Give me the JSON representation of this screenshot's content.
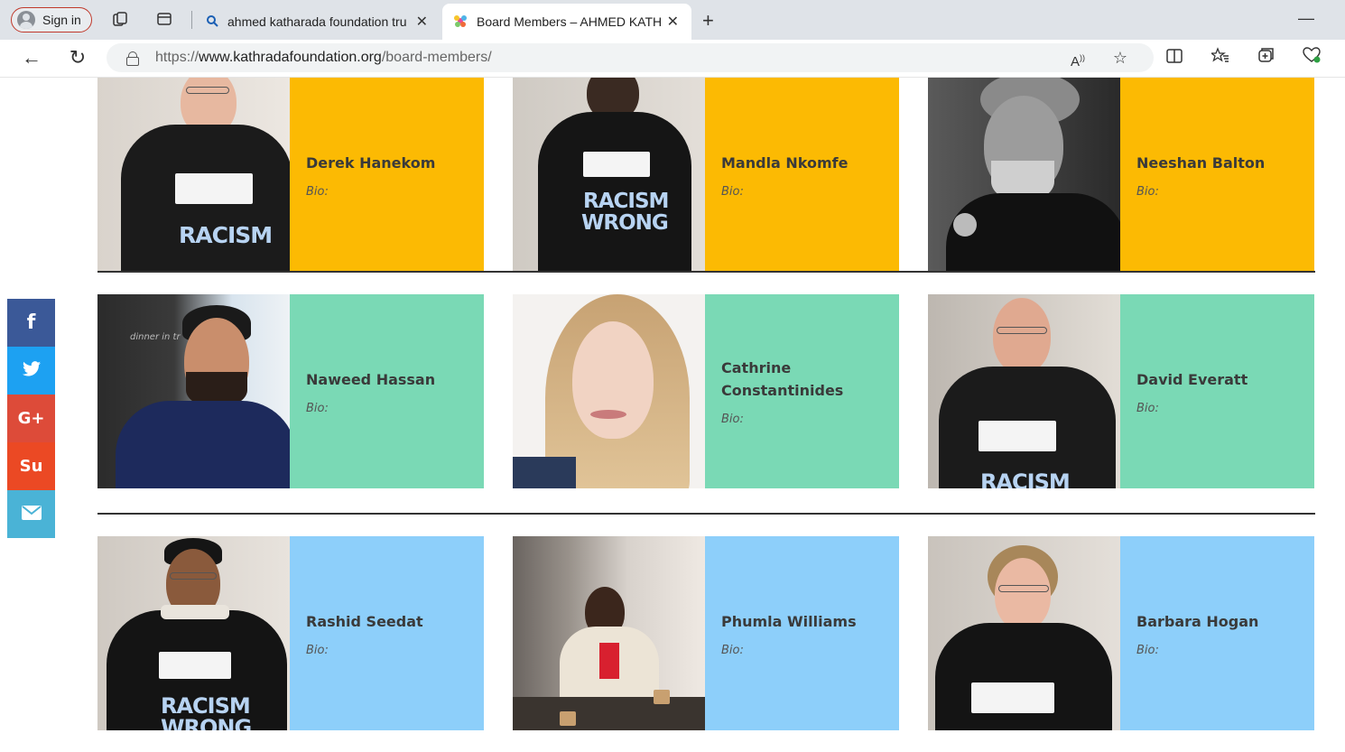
{
  "browser": {
    "signin_label": "Sign in",
    "tabs": [
      {
        "title": "ahmed katharada foundation tru",
        "active": false,
        "icon": "search-icon"
      },
      {
        "title": "Board Members – AHMED KATH",
        "active": true,
        "icon": "pinwheel-favicon"
      }
    ],
    "url_prefix": "https://",
    "url_host": "www.kathradafoundation.org",
    "url_path": "/board-members/"
  },
  "colors": {
    "row1": "#fcba03",
    "row2": "#7ad9b5",
    "row3": "#8dcffa"
  },
  "rows": [
    {
      "members": [
        {
          "name": "Derek Hanekom",
          "bio": "Bio:"
        },
        {
          "name": "Mandla Nkomfe",
          "bio": "Bio:"
        },
        {
          "name": "Neeshan Balton",
          "bio": "Bio:"
        }
      ]
    },
    {
      "members": [
        {
          "name": "Naweed Hassan",
          "bio": "Bio:"
        },
        {
          "name": "Cathrine Constantinides",
          "bio": "Bio:"
        },
        {
          "name": "David Everatt",
          "bio": "Bio:"
        }
      ]
    },
    {
      "members": [
        {
          "name": "Rashid Seedat",
          "bio": "Bio:"
        },
        {
          "name": "Phumla Williams",
          "bio": "Bio:"
        },
        {
          "name": "Barbara Hogan",
          "bio": "Bio:"
        }
      ]
    }
  ],
  "photo_text": {
    "shirt_racism": "RACISM",
    "shirt_wrong": "WRONG",
    "chair_text": "dinner in tr"
  },
  "social": [
    {
      "name": "facebook",
      "glyph": "f"
    },
    {
      "name": "twitter",
      "glyph": ""
    },
    {
      "name": "google-plus",
      "glyph": "G+"
    },
    {
      "name": "stumbleupon",
      "glyph": "Su"
    },
    {
      "name": "email",
      "glyph": ""
    }
  ]
}
